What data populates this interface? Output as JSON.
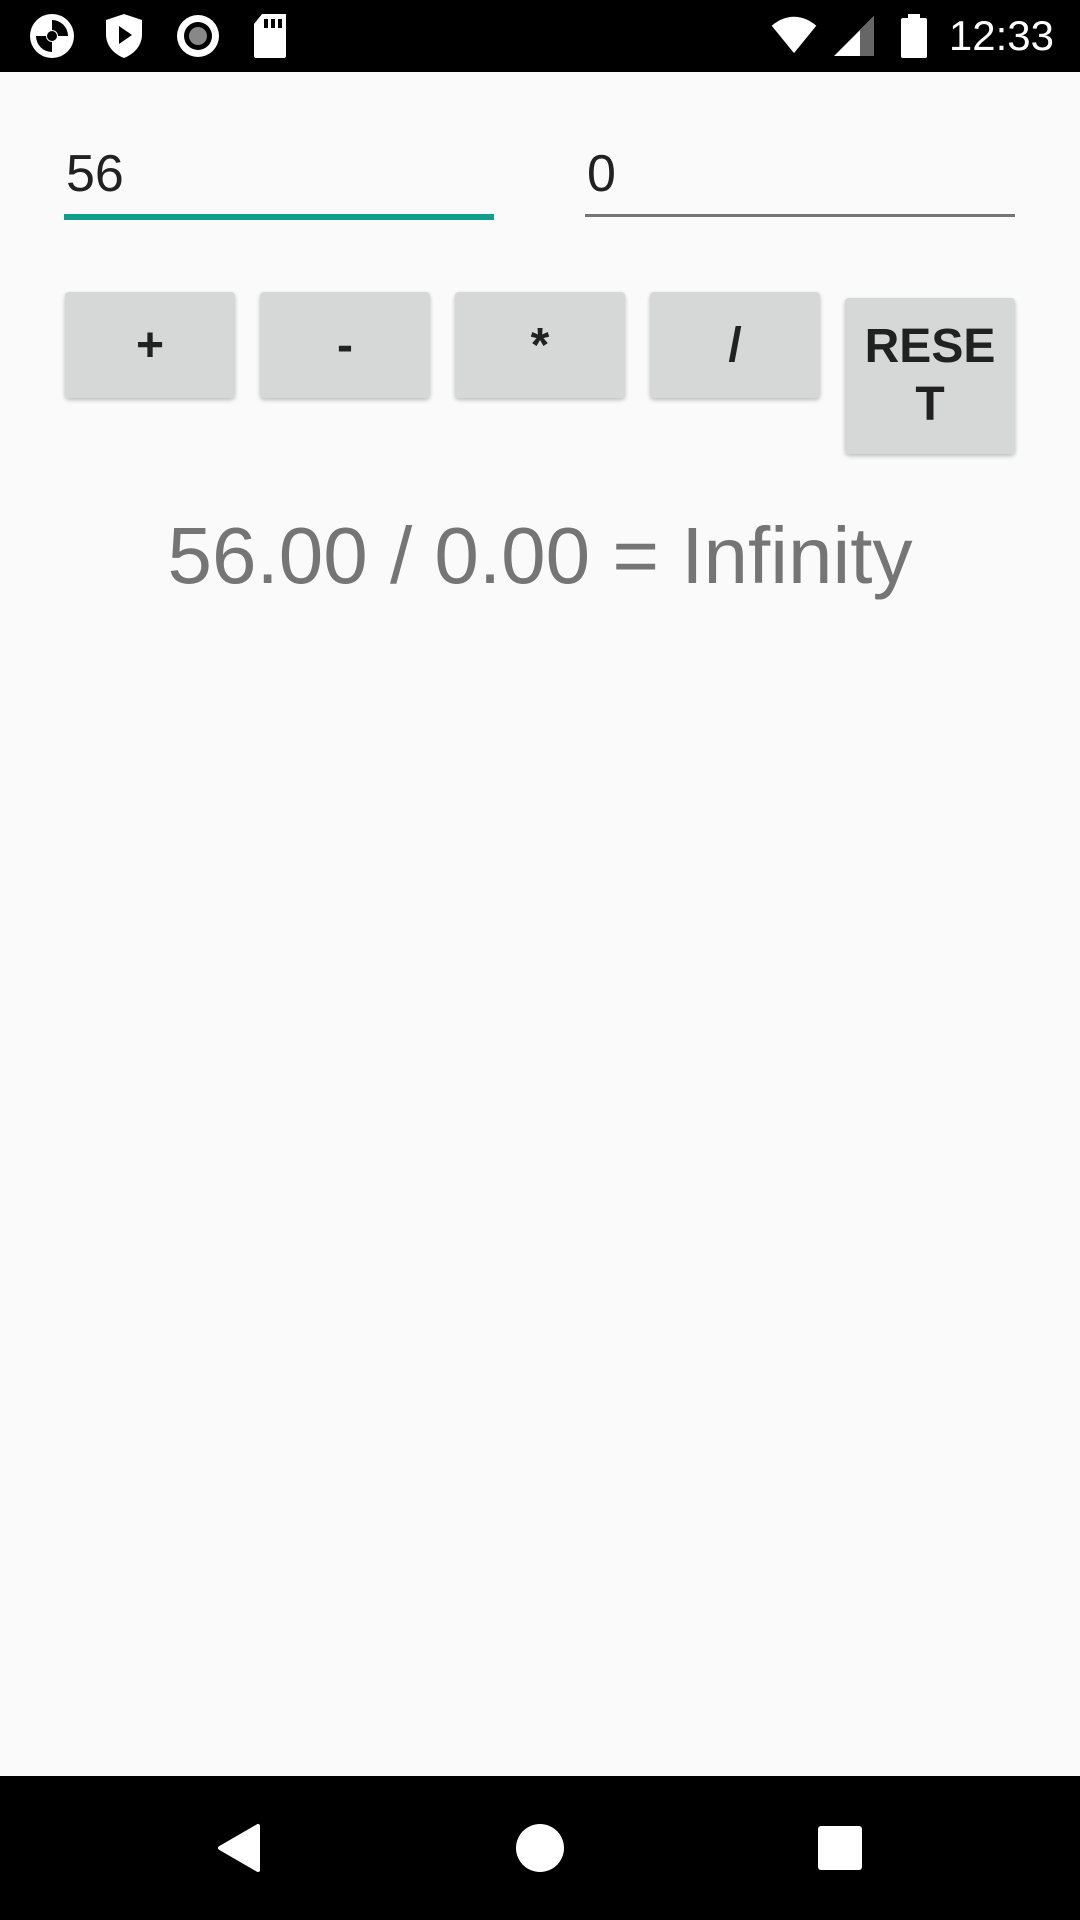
{
  "status_bar": {
    "icons": [
      "cleaner-app-icon",
      "shield-play-icon",
      "record-icon",
      "sd-card-icon",
      "wifi-icon",
      "cell-signal-icon",
      "battery-icon"
    ],
    "time": "12:33"
  },
  "inputs": {
    "first_value": "56",
    "second_value": "0",
    "focused_color": "#0f9d8c"
  },
  "buttons": {
    "add": "+",
    "subtract": "-",
    "multiply": "*",
    "divide": "/",
    "reset": "RESET"
  },
  "result": {
    "text": "56.00 / 0.00 = Infinity"
  },
  "nav_bar": {
    "icons": [
      "back-icon",
      "home-icon",
      "recents-icon"
    ]
  }
}
